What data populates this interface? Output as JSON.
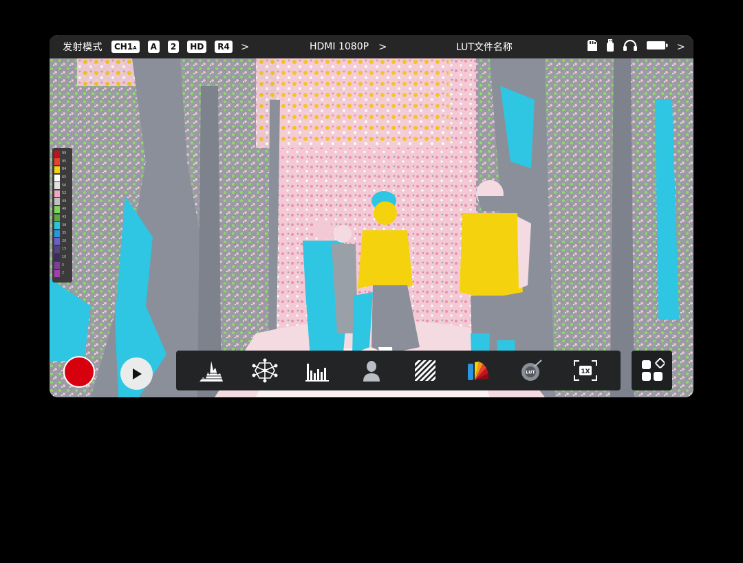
{
  "statusbar": {
    "mode_label": "发射模式",
    "channel": "CH1",
    "channel_sub": "A",
    "audio": "A",
    "audio_ch": "2",
    "quality": "HD",
    "rate": "R4",
    "input": "HDMI 1080P",
    "lut_name": "LUT文件名称",
    "chevron": ">"
  },
  "legend": {
    "colors": [
      "#c1121f",
      "#e6432c",
      "#f4d30e",
      "#ffffff",
      "#e1e1e1",
      "#f3a6bd",
      "#c0c0c0",
      "#7dd85a",
      "#5fa544",
      "#2cc3dc",
      "#2a96e0",
      "#6b5ecd",
      "#54437e",
      "#3b2f5a",
      "#7e3f98",
      "#a040b0"
    ],
    "values": [
      "99",
      "95",
      "84",
      "65",
      "56",
      "52",
      "49",
      "46",
      "43",
      "38",
      "35",
      "20",
      "15",
      "10",
      "5",
      "2"
    ]
  },
  "controls": {
    "record": "record",
    "play": "play"
  },
  "toolbar": {
    "tools": [
      {
        "name": "waveform",
        "icon": "waveform-icon"
      },
      {
        "name": "vectorscope",
        "icon": "vectorscope-icon"
      },
      {
        "name": "histogram",
        "icon": "histogram-icon"
      },
      {
        "name": "skin-tone",
        "icon": "person-icon"
      },
      {
        "name": "zebra",
        "icon": "zebra-icon"
      },
      {
        "name": "false-color",
        "icon": "false-color-icon"
      },
      {
        "name": "lut",
        "icon": "lut-icon"
      },
      {
        "name": "zoom",
        "icon": "zoom-1x-icon"
      }
    ],
    "lut_text": "LUT",
    "zoom_text": "1X"
  },
  "colors": {
    "record": "#d6000f",
    "statusbar": "#262626",
    "toolbar": "#222426"
  }
}
